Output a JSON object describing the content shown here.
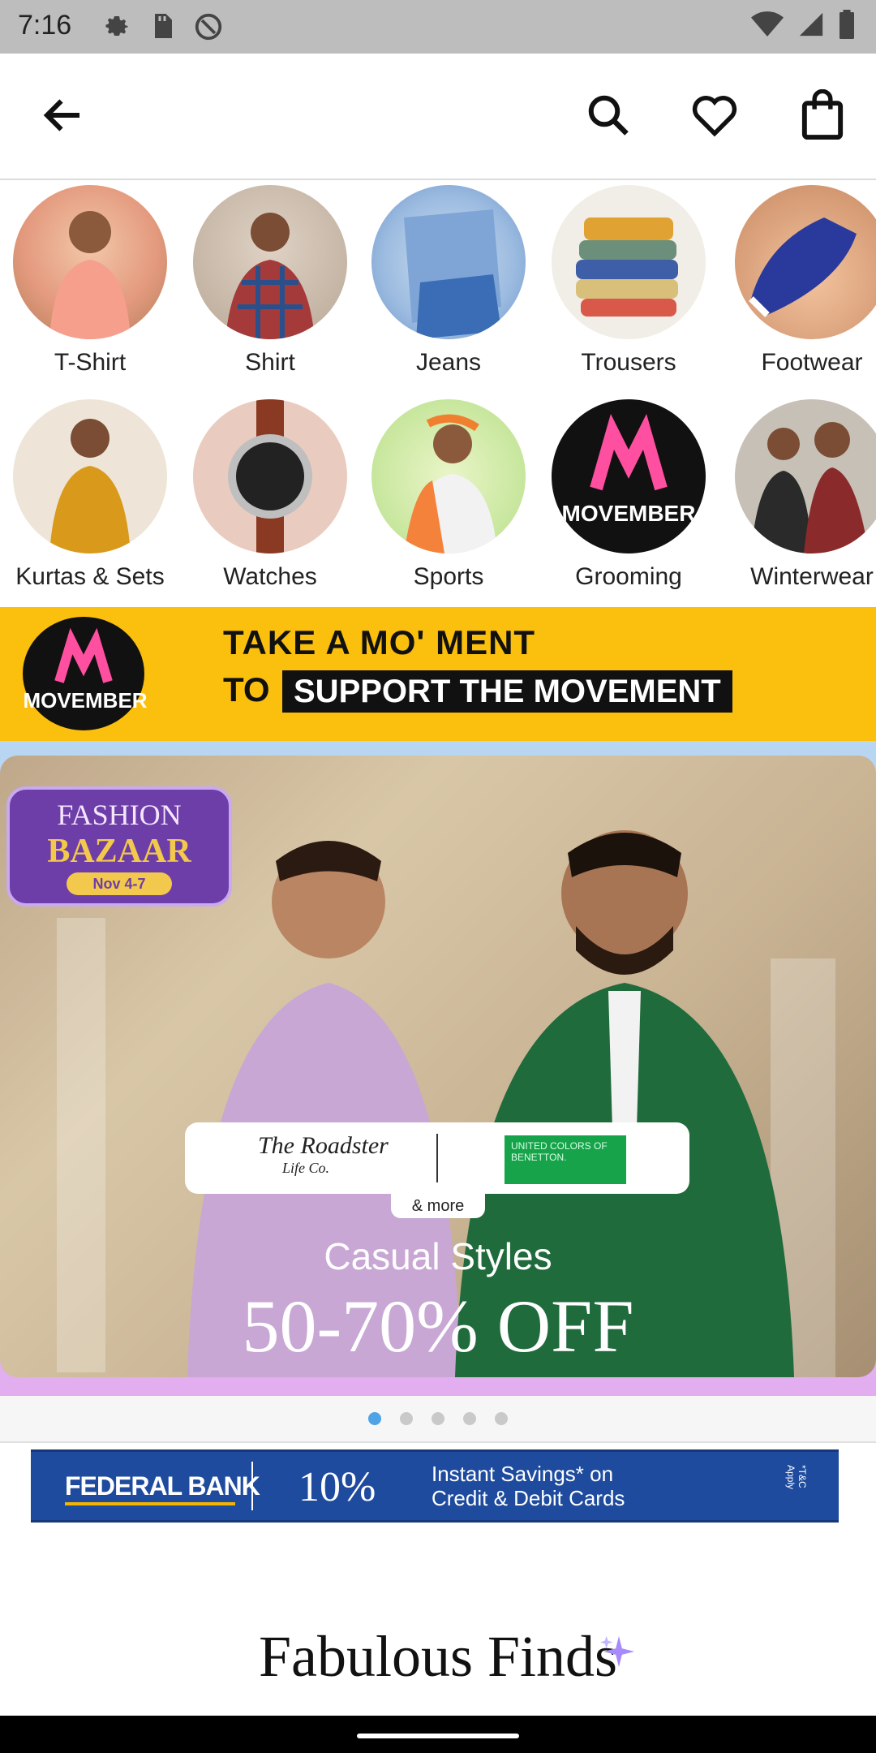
{
  "status": {
    "time": "7:16",
    "icons": [
      "gear-icon",
      "sd-card-icon",
      "at-sign-icon",
      "wifi-icon",
      "signal-icon",
      "battery-icon"
    ]
  },
  "header": {
    "icons": [
      "back-arrow-icon",
      "search-icon",
      "heart-icon",
      "bag-icon"
    ]
  },
  "categories": [
    {
      "label": "T-Shirt"
    },
    {
      "label": "Shirt"
    },
    {
      "label": "Jeans"
    },
    {
      "label": "Trousers"
    },
    {
      "label": "Footwear"
    },
    {
      "label": "Kurtas & Sets"
    },
    {
      "label": "Watches"
    },
    {
      "label": "Sports"
    },
    {
      "label": "Grooming"
    },
    {
      "label": "Winterwear"
    }
  ],
  "movember": {
    "badge": "MOVEMBER",
    "line1": "TAKE A MO' MENT",
    "to": "TO",
    "line2": "SUPPORT THE MOVEMENT"
  },
  "hero": {
    "badge_line1": "FASHION",
    "badge_line2": "BAZAAR",
    "badge_dates": "Nov 4-7",
    "brand1": "The Roadster",
    "brand1_sub": "Life Co.",
    "brand2": "UNITED COLORS OF BENETTON.",
    "more": "& more",
    "subtitle": "Casual Styles",
    "offer": "50-70% OFF"
  },
  "carousel": {
    "active_index": 0,
    "count": 5
  },
  "bank": {
    "name": "FEDERAL BANK",
    "percent": "10%",
    "text": "Instant Savings* on Credit & Debit Cards",
    "tc": "*T&C Apply"
  },
  "section": {
    "title": "Fabulous Finds"
  },
  "colors": {
    "movember_yellow": "#fbbf0d",
    "bank_blue": "#1e4b9e",
    "dot_active": "#4ea3e6"
  }
}
